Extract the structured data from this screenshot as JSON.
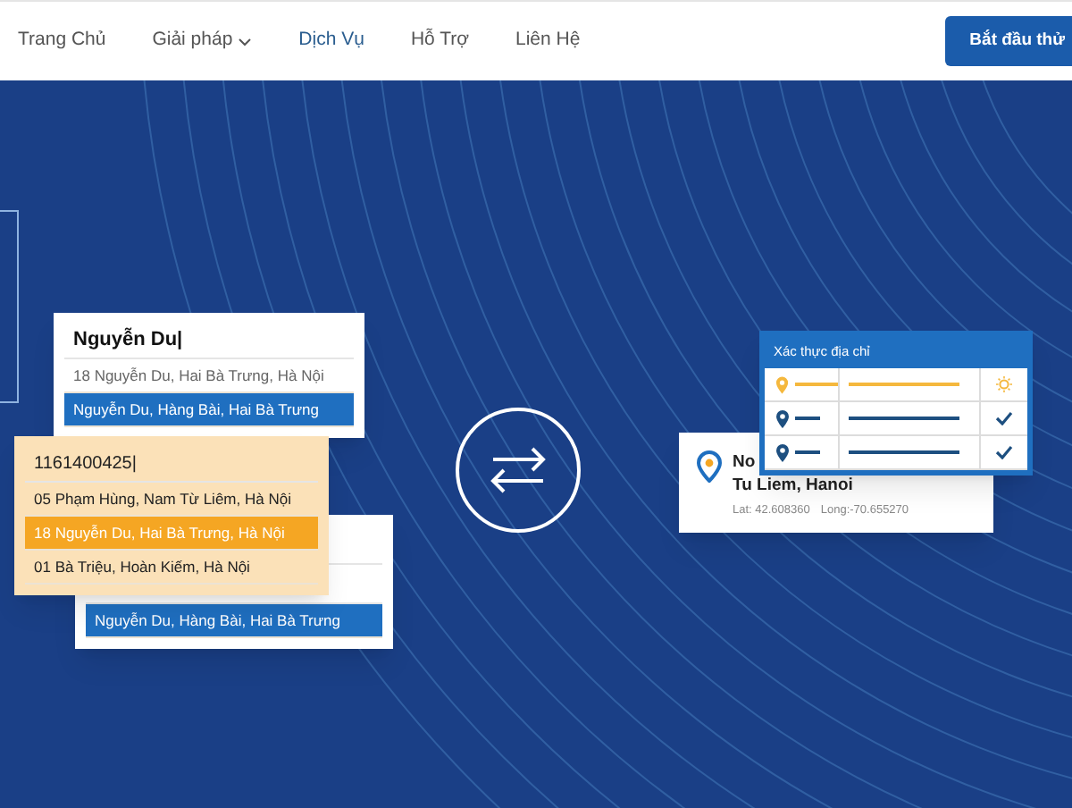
{
  "nav": {
    "items": [
      {
        "label": "Trang Chủ",
        "selected": false,
        "dropdown": false
      },
      {
        "label": "Giải pháp",
        "selected": false,
        "dropdown": true
      },
      {
        "label": "Dịch Vụ",
        "selected": true,
        "dropdown": false
      },
      {
        "label": "Hỗ Trợ",
        "selected": false,
        "dropdown": false
      },
      {
        "label": "Liên Hệ",
        "selected": false,
        "dropdown": false
      }
    ],
    "cta": "Bắt đầu thử"
  },
  "lookup_cards": [
    {
      "kind": "white",
      "query": "Nguyễn Du|",
      "results": [
        {
          "text": "18 Nguyễn Du, Hai Bà Trưng, Hà Nội",
          "selected": false
        },
        {
          "text": "Nguyễn Du, Hàng Bài, Hai Bà Trưng",
          "selected": true
        }
      ]
    },
    {
      "kind": "white",
      "results": [
        {
          "text": "Nguyễn Du, Hàng Bài, Hai Bà Trưng",
          "selected": true
        }
      ]
    },
    {
      "kind": "orange",
      "query": "1161400425|",
      "results": [
        {
          "text": "05 Phạm Hùng, Nam Từ Liêm, Hà Nội",
          "selected": false
        },
        {
          "text": "18 Nguyễn Du, Hai Bà Trưng, Hà Nội",
          "selected": true
        },
        {
          "text": "01 Bà Triệu, Hoàn Kiếm, Hà Nội",
          "selected": false
        }
      ]
    }
  ],
  "result_card": {
    "title": "No",
    "line": "Tu Liem, Hanoi",
    "lat": "Lat: 42.608360",
    "long": "Long:-70.655270"
  },
  "verify_card": {
    "title": "Xác thực địa chỉ",
    "rows": [
      {
        "verified": false
      },
      {
        "verified": true
      },
      {
        "verified": true
      }
    ]
  }
}
